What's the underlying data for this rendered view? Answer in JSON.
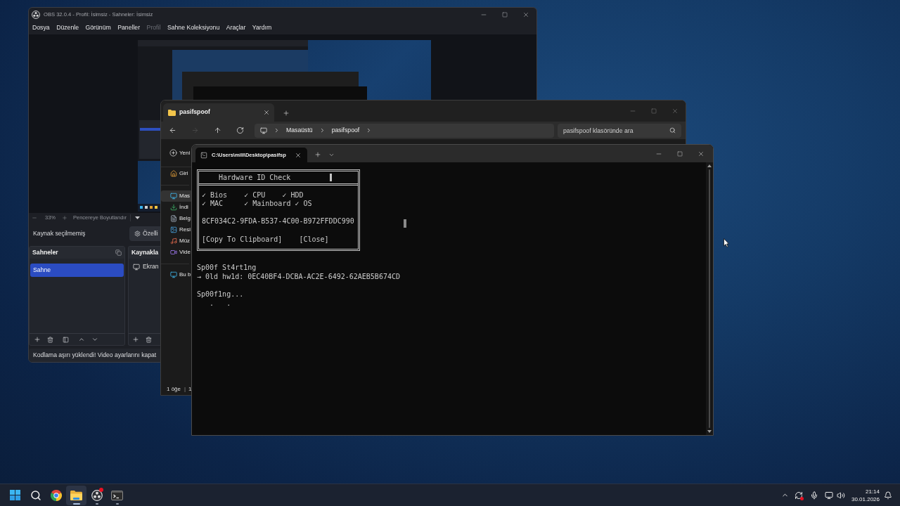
{
  "obs": {
    "title": "OBS 32.0.4 - Profil: İsimsiz - Sahneler: İsimsiz",
    "menu": [
      {
        "label": "Dosya",
        "disabled": false
      },
      {
        "label": "Düzenle",
        "disabled": false
      },
      {
        "label": "Görünüm",
        "disabled": false
      },
      {
        "label": "Paneller",
        "disabled": false
      },
      {
        "label": "Profil",
        "disabled": true
      },
      {
        "label": "Sahne Koleksiyonu",
        "disabled": false
      },
      {
        "label": "Araçlar",
        "disabled": false
      },
      {
        "label": "Yardım",
        "disabled": false
      }
    ],
    "zoom_bar": {
      "level_text": "33%",
      "fit_label": "Pencereye Boyutlandır"
    },
    "source_bar": {
      "label": "Kaynak seçilmemiş",
      "properties_button": "Özelli"
    },
    "scenes_panel": {
      "title": "Sahneler",
      "items": [
        {
          "label": "Sahne",
          "selected": true
        }
      ]
    },
    "sources_panel": {
      "title": "Kaynakla",
      "items": [
        {
          "label": "Ekran"
        }
      ]
    },
    "status_bar": "Kodlama aşırı yüklendi! Video ayarlarını kapat"
  },
  "explorer": {
    "tab": "pasifspoof",
    "nav": [
      {
        "kind": "back",
        "disabled": false
      },
      {
        "kind": "forward",
        "disabled": true
      },
      {
        "kind": "up",
        "disabled": false
      },
      {
        "kind": "refresh",
        "disabled": false
      }
    ],
    "breadcrumb": [
      "Masaüstü",
      "pasifspoof"
    ],
    "search": {
      "placeholder": "pasifspoof klasöründe ara"
    },
    "new_button": "Yeni",
    "sidebar": [
      {
        "kind": "home",
        "label": "Giri",
        "selected": false
      },
      {
        "kind": "desktop",
        "label": "Mas",
        "selected": true
      },
      {
        "kind": "downloads",
        "label": "İndi",
        "selected": false
      },
      {
        "kind": "documents",
        "label": "Belg",
        "selected": false
      },
      {
        "kind": "pictures",
        "label": "Resi",
        "selected": false
      },
      {
        "kind": "music",
        "label": "Müz",
        "selected": false
      },
      {
        "kind": "videos",
        "label": "Vide",
        "selected": false
      },
      {
        "kind": "computer",
        "label": "Bu b",
        "selected": false
      }
    ],
    "status": {
      "count": "1 öğe",
      "separator": "|",
      "selection": "1"
    }
  },
  "terminal": {
    "tab": "C:\\Users\\mili\\Desktop\\pasifsp",
    "dialog": {
      "title": "Hardware ID Check",
      "check_rows": [
        "✓ Bios    ✓ CPU    ✓ HDD",
        "✓ MAC     ✓ Mainboard ✓ OS"
      ],
      "hwid": "8CF034C2-9FDA-B537-4C00-B972FFDDC990",
      "buttons": [
        "[Copy To Clipboard]",
        "[Close]"
      ]
    },
    "blocks": [
      [
        "Sp00f St4rt1ng",
        "→ 0ld hw1d: 0EC40BF4-DCBA-AC2E-6492-62AEB5B674CD"
      ],
      [
        "Sp00f1ng...",
        "   .   ."
      ]
    ]
  },
  "taskbar": {
    "apps": [
      {
        "kind": "start",
        "selected": false,
        "running": false,
        "badge": false
      },
      {
        "kind": "search",
        "selected": false,
        "running": false,
        "badge": false
      },
      {
        "kind": "browser",
        "selected": false,
        "running": false,
        "badge": false
      },
      {
        "kind": "files",
        "selected": true,
        "running": true,
        "badge": false
      },
      {
        "kind": "recorder",
        "selected": false,
        "running": true,
        "badge": true
      },
      {
        "kind": "terminal",
        "selected": false,
        "running": true,
        "badge": false
      }
    ],
    "clock": {
      "time": "21:14",
      "date": "30.01.2026"
    }
  }
}
